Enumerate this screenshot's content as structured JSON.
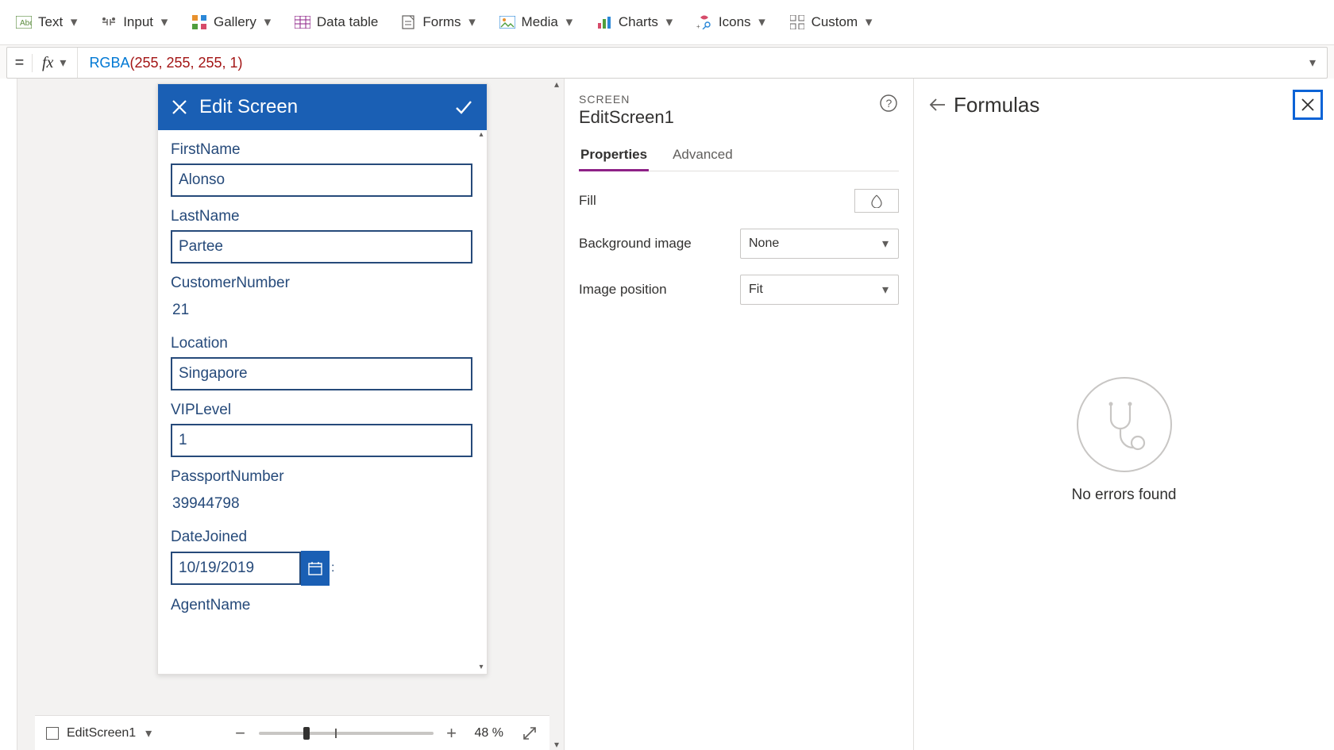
{
  "ribbon": {
    "items": [
      {
        "label": "Text",
        "icon": "text-icon"
      },
      {
        "label": "Input",
        "icon": "input-icon"
      },
      {
        "label": "Gallery",
        "icon": "gallery-icon"
      },
      {
        "label": "Data table",
        "icon": "datatable-icon"
      },
      {
        "label": "Forms",
        "icon": "forms-icon"
      },
      {
        "label": "Media",
        "icon": "media-icon"
      },
      {
        "label": "Charts",
        "icon": "charts-icon"
      },
      {
        "label": "Icons",
        "icon": "icons-icon"
      },
      {
        "label": "Custom",
        "icon": "custom-icon"
      }
    ]
  },
  "formula": {
    "eq": "=",
    "fx": "fx",
    "fn_name": "RGBA",
    "args_display": "(255, 255, 255, 1)"
  },
  "phone": {
    "title": "Edit Screen",
    "fields": [
      {
        "label": "FirstName",
        "value": "Alonso",
        "editable": true
      },
      {
        "label": "LastName",
        "value": "Partee",
        "editable": true
      },
      {
        "label": "CustomerNumber",
        "value": "21",
        "editable": false
      },
      {
        "label": "Location",
        "value": "Singapore",
        "editable": true
      },
      {
        "label": "VIPLevel",
        "value": "1",
        "editable": true
      },
      {
        "label": "PassportNumber",
        "value": "39944798",
        "editable": false
      },
      {
        "label": "DateJoined",
        "value": "10/19/2019",
        "editable": true,
        "type": "date"
      },
      {
        "label": "AgentName",
        "value": "",
        "editable": true
      }
    ]
  },
  "footer": {
    "breadcrumb": "EditScreen1",
    "zoom_pct": "48",
    "zoom_unit": "%"
  },
  "properties": {
    "type_label": "SCREEN",
    "name": "EditScreen1",
    "tabs": {
      "properties": "Properties",
      "advanced": "Advanced"
    },
    "rows": {
      "fill": "Fill",
      "background_image": {
        "label": "Background image",
        "value": "None"
      },
      "image_position": {
        "label": "Image position",
        "value": "Fit"
      }
    }
  },
  "formulas": {
    "title": "Formulas",
    "empty_message": "No errors found"
  }
}
